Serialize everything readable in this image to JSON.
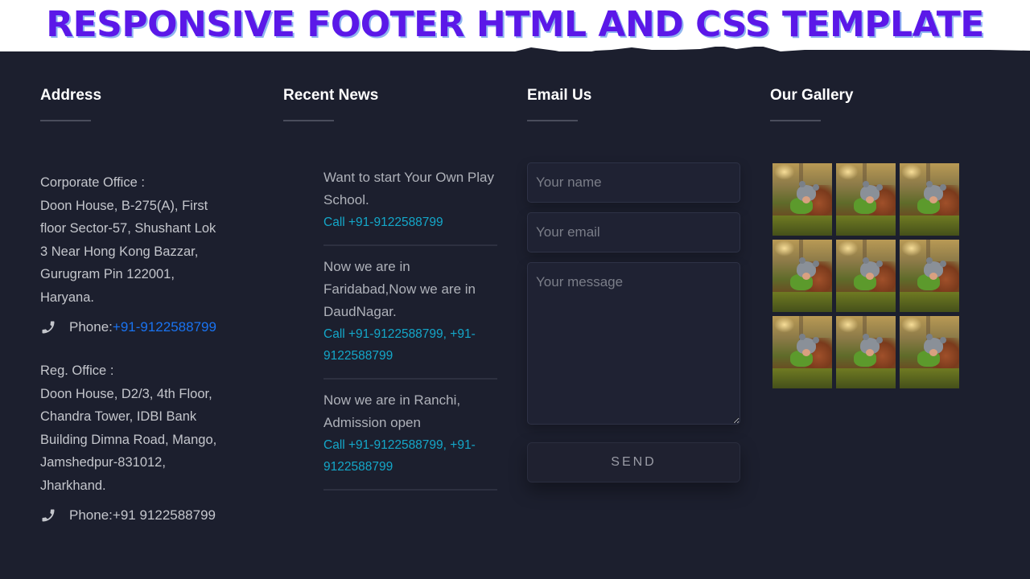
{
  "banner": {
    "title": "RESPONSIVE FOOTER HTML AND CSS TEMPLATE"
  },
  "address": {
    "heading": "Address",
    "offices": [
      {
        "label": "Corporate Office :",
        "lines": [
          "Doon House, B-275(A), First",
          "floor Sector-57, Shushant Lok",
          "3 Near Hong Kong Bazzar,",
          "Gurugram Pin 122001,",
          "Haryana."
        ],
        "phone_label": "Phone: ",
        "phone_value": "+91-9122588799",
        "phone_is_link": true,
        "icon": "phone-icon"
      },
      {
        "label": "Reg. Office :",
        "lines": [
          "Doon House, D2/3, 4th Floor,",
          "Chandra Tower, IDBI Bank",
          "Building Dimna Road, Mango,",
          "Jamshedpur-831012,",
          "Jharkhand."
        ],
        "phone_label": "Phone: ",
        "phone_value": "+91 9122588799",
        "phone_is_link": false,
        "icon": "phone-icon"
      }
    ]
  },
  "news": {
    "heading": "Recent News",
    "items": [
      {
        "text": "Want to start Your Own Play School.",
        "call": "Call +91-9122588799"
      },
      {
        "text": "Now we are in Faridabad,Now we are in DaudNagar.",
        "call": "Call +91-9122588799, +91-9122588799"
      },
      {
        "text": "Now we are in Ranchi, Admission open",
        "call": "Call +91-9122588799, +91-9122588799"
      }
    ]
  },
  "email": {
    "heading": "Email Us",
    "name_placeholder": "Your name",
    "name_value": "",
    "email_placeholder": "Your email",
    "email_value": "",
    "message_placeholder": "Your message",
    "message_value": "",
    "send_label": "SEND"
  },
  "gallery": {
    "heading": "Our Gallery",
    "images": [
      {
        "alt": "child in knit hat in forest"
      },
      {
        "alt": "child in knit hat in forest"
      },
      {
        "alt": "child in knit hat in forest"
      },
      {
        "alt": "child in knit hat in forest"
      },
      {
        "alt": "child in knit hat in forest"
      },
      {
        "alt": "child in knit hat in forest"
      },
      {
        "alt": "child in knit hat in forest"
      },
      {
        "alt": "child in knit hat in forest"
      },
      {
        "alt": "child in knit hat in forest"
      }
    ]
  },
  "colors": {
    "banner_title": "#5b18e8",
    "footer_bg": "#1c1f2e",
    "link_blue": "#1a73f0",
    "call_cyan": "#14a7c9"
  }
}
